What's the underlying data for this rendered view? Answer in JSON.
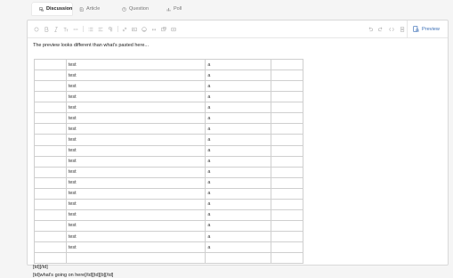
{
  "tabs": [
    {
      "label": "Discussion",
      "icon": "discussion-icon",
      "active": true
    },
    {
      "label": "Article",
      "icon": "article-icon",
      "active": false
    },
    {
      "label": "Question",
      "icon": "question-icon",
      "active": false
    },
    {
      "label": "Poll",
      "icon": "poll-icon",
      "active": false
    }
  ],
  "toolbar": {
    "preview_label": "Preview",
    "accent": "#3b6fb6"
  },
  "content": {
    "intro": "The preview looks different than what's pasted here...",
    "table_rows": [
      [
        "",
        "test",
        "a",
        ""
      ],
      [
        "",
        "test",
        "a",
        ""
      ],
      [
        "",
        "test",
        "a",
        ""
      ],
      [
        "",
        "test",
        "a",
        ""
      ],
      [
        "",
        "test",
        "a",
        ""
      ],
      [
        "",
        "test",
        "a",
        ""
      ],
      [
        "",
        "test",
        "a",
        ""
      ],
      [
        "",
        "test",
        "a",
        ""
      ],
      [
        "",
        "test",
        "a",
        ""
      ],
      [
        "",
        "test",
        "a",
        ""
      ],
      [
        "",
        "test",
        "a",
        ""
      ],
      [
        "",
        "test",
        "a",
        ""
      ],
      [
        "",
        "test",
        "a",
        ""
      ],
      [
        "",
        "test",
        "a",
        ""
      ],
      [
        "",
        "test",
        "a",
        ""
      ],
      [
        "",
        "test",
        "a",
        ""
      ],
      [
        "",
        "test",
        "a",
        ""
      ],
      [
        "",
        "test",
        "a",
        ""
      ],
      [
        "",
        "",
        "",
        ""
      ]
    ],
    "line1": "[td][/td]",
    "line2": "[td]what's going on here[/td][td][b][/td]"
  }
}
